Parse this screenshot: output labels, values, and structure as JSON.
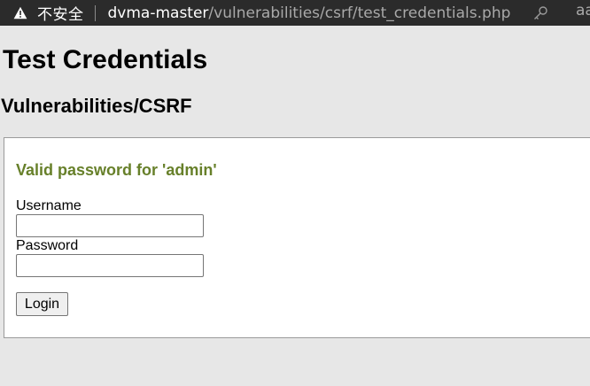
{
  "browser": {
    "security_warning": "不安全",
    "url_host": "dvma-master",
    "url_path": "/vulnerabilities/csrf/test_credentials.php",
    "reader_partial": "aa",
    "icons": {
      "warning": "warning-triangle-icon",
      "key": "key-icon"
    }
  },
  "page": {
    "title": "Test Credentials",
    "subtitle": "Vulnerabilities/CSRF"
  },
  "form": {
    "message": "Valid password for 'admin'",
    "username_label": "Username",
    "username_value": "",
    "password_label": "Password",
    "password_value": "",
    "login_label": "Login"
  },
  "colors": {
    "message": "#67802a",
    "background": "#e7e7e7",
    "addressbar": "#2b2b2b"
  }
}
